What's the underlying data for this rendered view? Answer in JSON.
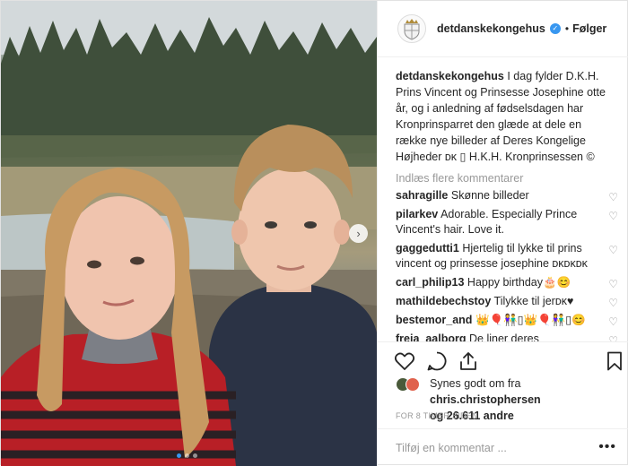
{
  "post": {
    "username": "detdanskekongehus",
    "separator": "•",
    "follow_label": "Følger",
    "caption_user": "detdanskekongehus",
    "caption_text": "I dag fylder D.K.H. Prins Vincent og Prinsesse Josephine otte år, og i anledning af fødselsdagen har Kronprinsparret den glæde at dele en række nye billeder af Deres Kongelige Højheder ᴅᴋ ▯ H.K.H. Kronprinsessen ©",
    "load_more": "Indlæs flere kommentarer",
    "comments": [
      {
        "user": "sahragille",
        "text": "Skønne billeder"
      },
      {
        "user": "pilarkev",
        "text": "Adorable. Especially Prince Vincent's hair. Love it."
      },
      {
        "user": "gaggedutti1",
        "text": "Hjertelig til lykke til prins vincent og prinsesse josephine ᴅᴋᴅᴋᴅᴋ"
      },
      {
        "user": "carl_philip13",
        "text": "Happy birthday🎂😊"
      },
      {
        "user": "mathildebechstoy",
        "text": "Tilykke til jerᴅᴋ♥"
      },
      {
        "user": "bestemor_and",
        "text": "👑🎈👫▯👑🎈👫▯😊"
      },
      {
        "user": "freja_aalborg",
        "text": "De liner deres søskende,"
      }
    ],
    "liked_by_prefix": "Synes godt om fra",
    "liked_by_user": "chris.christophersen",
    "liked_by_suffix": "og 26.611 andre",
    "timestamp": "FOR 8 TIMER SIDEN",
    "comment_placeholder": "Tilføj en kommentar ...",
    "more_icon_text": "•••",
    "nav_arrow_text": "›"
  },
  "icons": {
    "verified": "verified-badge-icon",
    "heart": "heart-icon",
    "comment": "comment-icon",
    "share": "share-icon",
    "bookmark": "bookmark-icon"
  },
  "carousel": {
    "count": 3,
    "active_index": 0
  },
  "colors": {
    "accent": "#3897f0",
    "muted": "#999999",
    "text": "#262626"
  }
}
